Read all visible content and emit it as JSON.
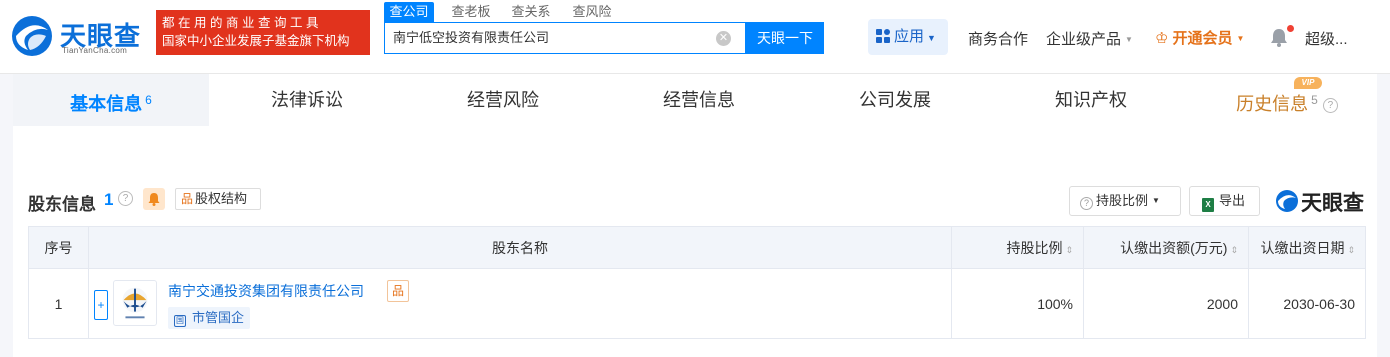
{
  "header": {
    "logo_title": "天眼查",
    "logo_sub": "TianYanCha.com",
    "promo_line1": "都在用的商业查询工具",
    "promo_line2": "国家中小企业发展子基金旗下机构",
    "search_tabs": [
      "查公司",
      "查老板",
      "查关系",
      "查风险"
    ],
    "search_value": "南宁低空投资有限责任公司",
    "search_button": "天眼一下",
    "apps_label": "应用",
    "nav": {
      "business": "商务合作",
      "enterprise": "企业级产品",
      "vip": "开通会员",
      "user": "超级..."
    }
  },
  "tabs": [
    {
      "label": "基本信息",
      "count": "6"
    },
    {
      "label": "法律诉讼",
      "count": ""
    },
    {
      "label": "经营风险",
      "count": ""
    },
    {
      "label": "经营信息",
      "count": ""
    },
    {
      "label": "公司发展",
      "count": ""
    },
    {
      "label": "知识产权",
      "count": ""
    },
    {
      "label": "历史信息",
      "count": "5"
    }
  ],
  "vip_badge": "VIP",
  "section": {
    "title": "股东信息",
    "count": "1",
    "struct_button": "股权结构",
    "ratio_button": "持股比例",
    "export_button": "导出",
    "watermark": "天眼查"
  },
  "table": {
    "headers": {
      "index": "序号",
      "name": "股东名称",
      "ratio": "持股比例",
      "amount": "认缴出资额(万元)",
      "date": "认缴出资日期"
    },
    "rows": [
      {
        "index": "1",
        "name": "南宁交通投资集团有限责任公司",
        "tag": "市管国企",
        "ratio": "100%",
        "amount": "2000",
        "date": "2030-06-30"
      }
    ]
  },
  "colors": {
    "brand": "#0084ff",
    "promo": "#e1331d",
    "vip": "#e5721a"
  }
}
